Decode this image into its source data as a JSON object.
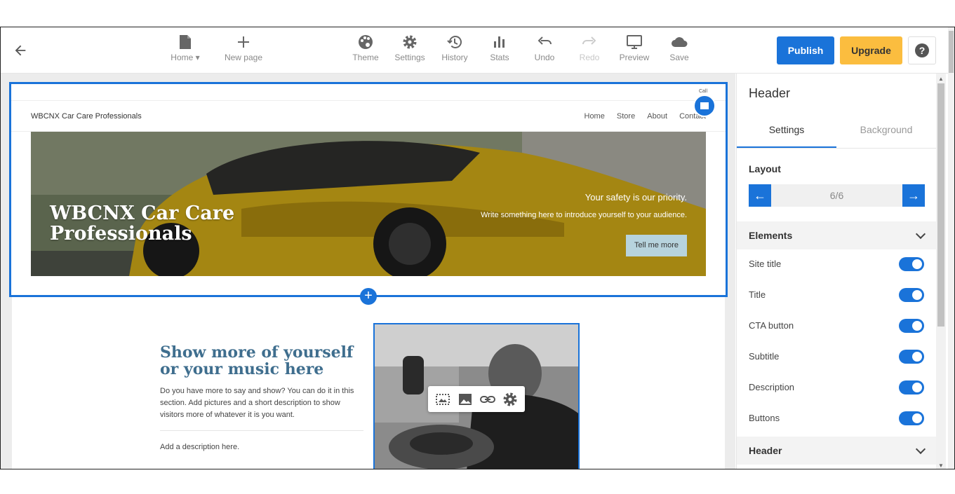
{
  "toolbar": {
    "home_label": "Home",
    "new_page_label": "New page",
    "theme_label": "Theme",
    "settings_label": "Settings",
    "history_label": "History",
    "stats_label": "Stats",
    "undo_label": "Undo",
    "redo_label": "Redo",
    "preview_label": "Preview",
    "save_label": "Save",
    "publish_label": "Publish",
    "upgrade_label": "Upgrade",
    "help_label": "?"
  },
  "site": {
    "call_label": "Call",
    "title": "WBCNX Car Care Professionals",
    "nav": [
      "Home",
      "Store",
      "About",
      "Contact"
    ],
    "hero": {
      "title": "WBCNX Car Care Professionals",
      "subtitle": "Your safety is our priority.",
      "description": "Write something here to introduce yourself to your audience.",
      "cta": "Tell me more"
    },
    "content": {
      "title": "Show more of yourself or your music here",
      "text": "Do you have more to say and show? You can do it in this section. Add pictures and a short description to show visitors more of whatever it is you want.",
      "desc": "Add a description here."
    }
  },
  "panel": {
    "title": "Header",
    "tabs": [
      "Settings",
      "Background"
    ],
    "layout_label": "Layout",
    "layout_value": "6/6",
    "elements_label": "Elements",
    "elements": [
      {
        "label": "Site title",
        "on": true
      },
      {
        "label": "Title",
        "on": true
      },
      {
        "label": "CTA button",
        "on": true
      },
      {
        "label": "Subtitle",
        "on": true
      },
      {
        "label": "Description",
        "on": true
      },
      {
        "label": "Buttons",
        "on": true
      }
    ],
    "header_section_label": "Header"
  },
  "colors": {
    "accent": "#1a73d9",
    "upgrade": "#fbbd3f",
    "content_title": "#3f6e8e",
    "hero_cta": "#b7d3dd"
  }
}
